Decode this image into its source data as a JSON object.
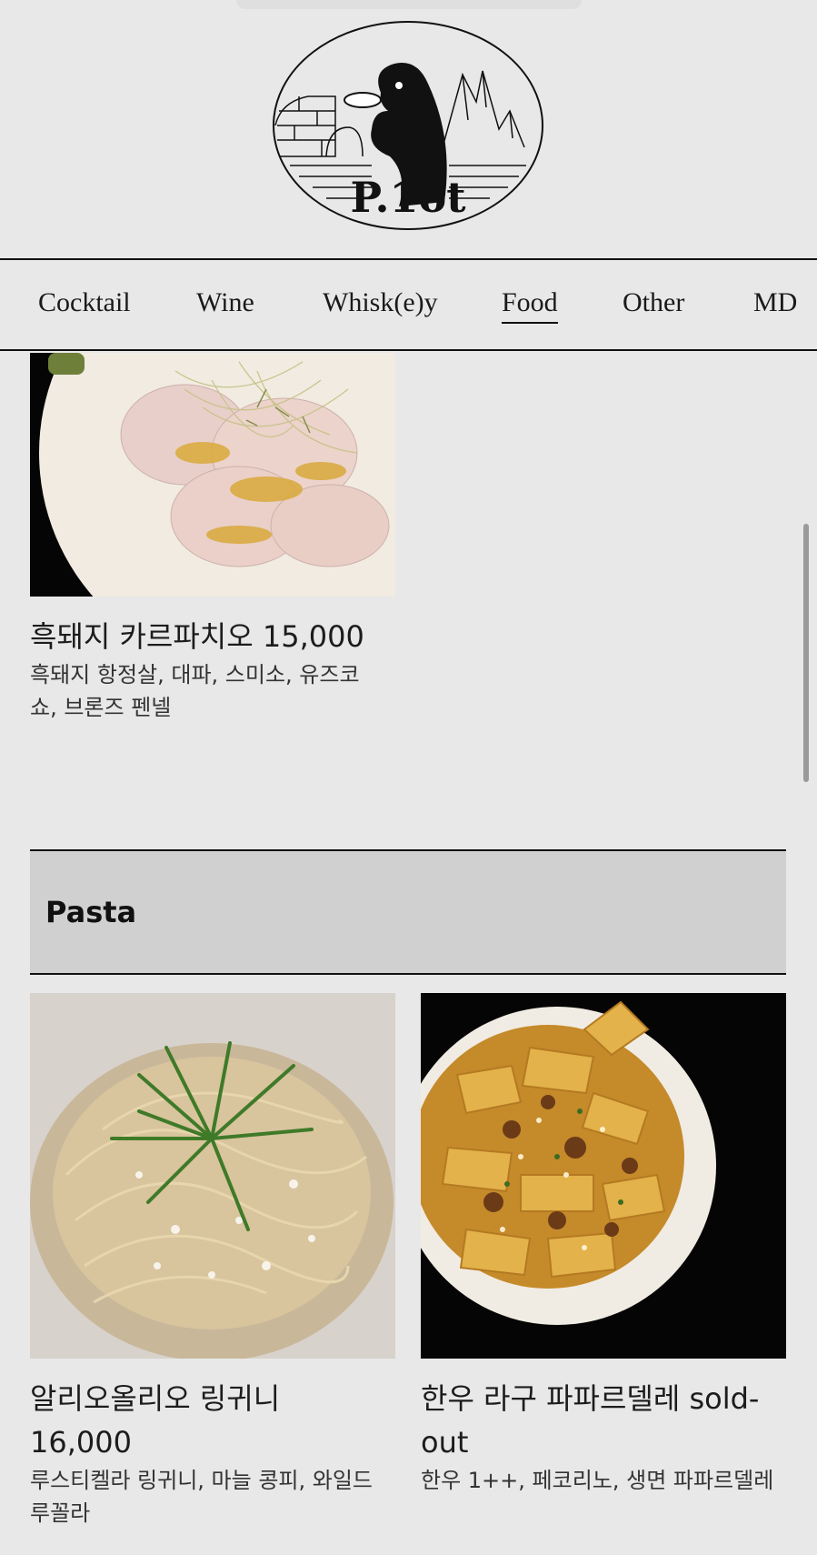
{
  "brand": {
    "logo_text": "P.1ot",
    "logo_icon": "penguin-igloo-mountains-logo"
  },
  "nav": {
    "items": [
      {
        "label": "Cocktail"
      },
      {
        "label": "Wine"
      },
      {
        "label": "Whisk(e)y"
      },
      {
        "label": "Food",
        "active": true
      },
      {
        "label": "Other"
      },
      {
        "label": "MD"
      }
    ]
  },
  "items": [
    {
      "title": "흑돼지 카르파치오 15,000",
      "desc_line1": "흑돼지 항정살, 대파, 스미소, 유즈코",
      "desc_line2": "쇼, 브론즈 펜넬",
      "image": "carpaccio-photo"
    }
  ],
  "section": {
    "title": "Pasta"
  },
  "pasta_items": [
    {
      "title_line1": "알리오올리오 링귀니",
      "title_line2": "16,000",
      "desc_line1": "루스티켈라 링귀니, 마늘 콩피, 와일드",
      "desc_line2": "루꼴라",
      "image": "aglio-olio-photo"
    },
    {
      "title_line1": "한우 라구 파파르델레 sold-",
      "title_line2": "out",
      "desc_line1": "한우 1++, 페코리노, 생면 파파르델레",
      "image": "ragu-pappardelle-photo"
    }
  ],
  "colors": {
    "background": "#e8e8e8",
    "section_bg": "#d0d0d0",
    "text": "#1d1d1d"
  }
}
